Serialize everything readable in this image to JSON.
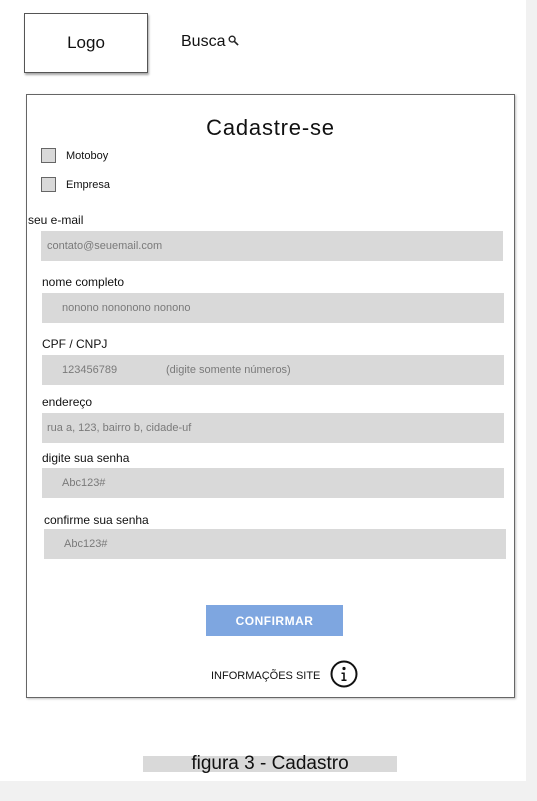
{
  "header": {
    "logo_label": "Logo",
    "search_label": "Busca",
    "search_icon": "search-icon"
  },
  "form": {
    "title": "Cadastre-se",
    "account_types": [
      "Motoboy",
      "Empresa"
    ],
    "fields": [
      {
        "label": "seu e-mail",
        "placeholder": "contato@seuemail.com",
        "hint": ""
      },
      {
        "label": "nome completo",
        "placeholder": "nonono nononono nonono",
        "hint": ""
      },
      {
        "label": "CPF / CNPJ",
        "placeholder": "123456789",
        "hint": "(digite somente números)"
      },
      {
        "label": "endereço",
        "placeholder": "rua a, 123, bairro b, cidade-uf",
        "hint": ""
      },
      {
        "label": "digite sua senha",
        "placeholder": "Abc123#",
        "hint": ""
      },
      {
        "label": "confirme sua senha",
        "placeholder": "Abc123#",
        "hint": ""
      }
    ],
    "confirm_label": "CONFIRMAR",
    "confirm_color": "#7ea6e0",
    "info_label": "INFORMAÇÕES SITE",
    "info_icon": "info-icon"
  },
  "caption": "figura 3 - Cadastro"
}
